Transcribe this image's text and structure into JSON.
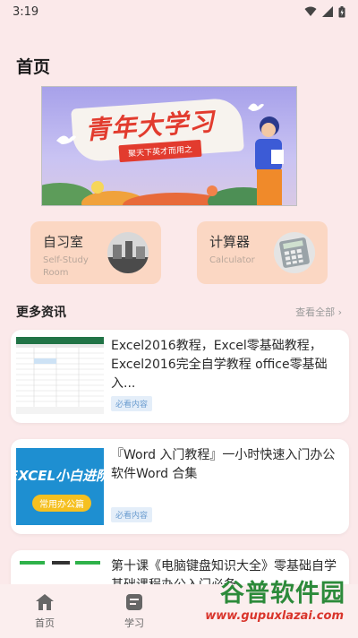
{
  "status_bar": {
    "time": "3:19"
  },
  "page_title": "首页",
  "banner": {
    "title": "青年大学习",
    "subtitle": "聚天下英才而用之"
  },
  "features": [
    {
      "title": "自习室",
      "subtitle": "Self-Study Room"
    },
    {
      "title": "计算器",
      "subtitle": "Calculator"
    }
  ],
  "section": {
    "title": "更多资讯",
    "more": "查看全部 ›"
  },
  "news": [
    {
      "text": "Excel2016教程，Excel零基础教程，Excel2016完全自学教程 office零基础入...",
      "tag": "必看内容"
    },
    {
      "text": "『Word 入门教程』一小时快速入门办公软件Word 合集",
      "tag": "必看内容",
      "thumb_text": "EXCEL小白进阶",
      "thumb_badge": "常用办公篇"
    },
    {
      "text": "第十课《电脑键盘知识大全》零基础自学基础课程办公入门必备",
      "tag": ""
    }
  ],
  "nav": [
    {
      "label": "首页",
      "icon": "home-icon"
    },
    {
      "label": "学习",
      "icon": "study-icon"
    }
  ],
  "watermark": {
    "main": "谷普软件园",
    "url": "www.gupuxlazai.com"
  },
  "colors": {
    "background": "#fbe9ea",
    "card": "#fbd7c3",
    "tag": "#6a9cd0",
    "accent": "#e23b2e"
  }
}
